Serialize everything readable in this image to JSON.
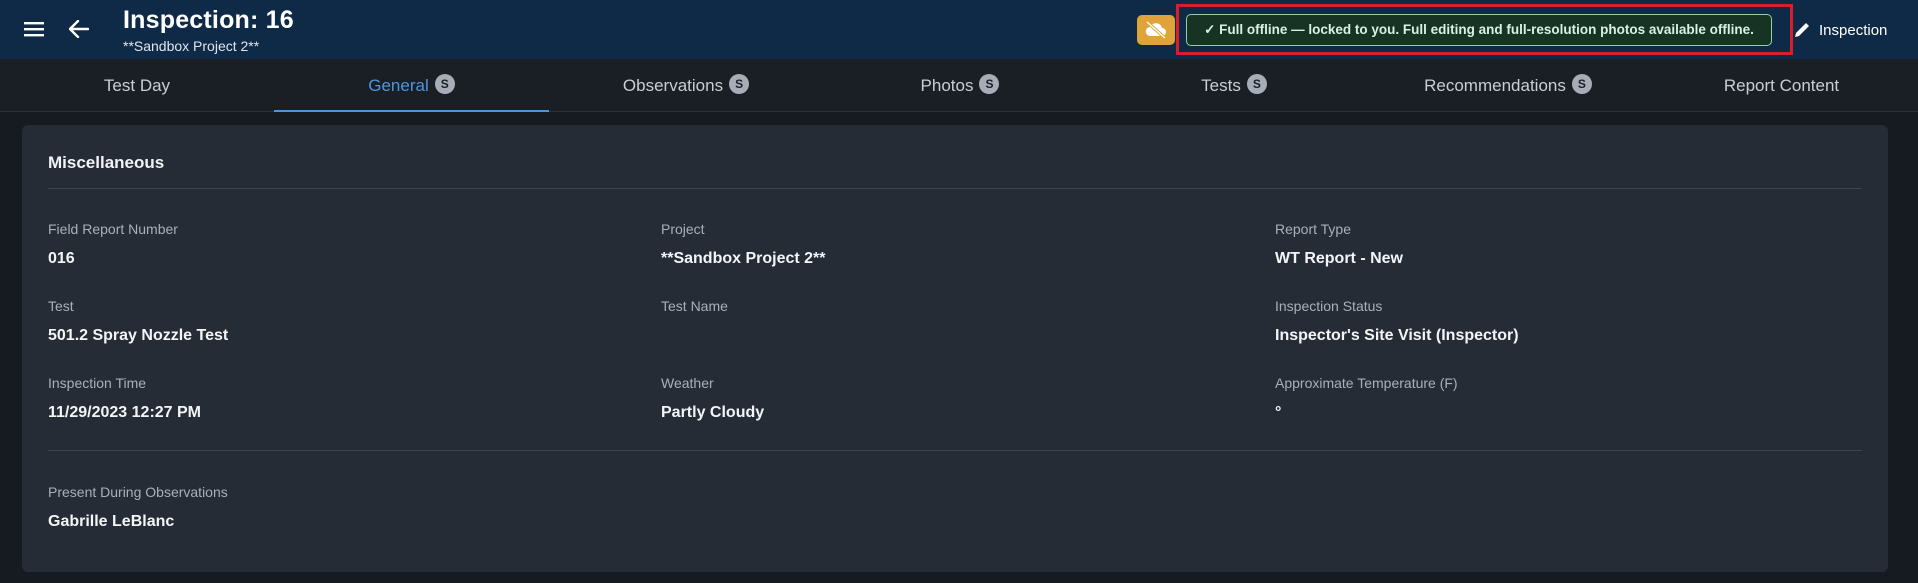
{
  "header": {
    "title": "Inspection: 16",
    "subtitle": "**Sandbox Project 2**",
    "offline_banner": "✓ Full offline — locked to you. Full editing and full-resolution photos available offline.",
    "edit_label": "Inspection"
  },
  "tabs": [
    {
      "label": "Test Day",
      "badge": ""
    },
    {
      "label": "General",
      "badge": "S"
    },
    {
      "label": "Observations",
      "badge": "S"
    },
    {
      "label": "Photos",
      "badge": "S"
    },
    {
      "label": "Tests",
      "badge": "S"
    },
    {
      "label": "Recommendations",
      "badge": "S"
    },
    {
      "label": "Report Content",
      "badge": ""
    }
  ],
  "active_tab": "General",
  "section": {
    "title": "Miscellaneous",
    "fields": {
      "field_report_number": {
        "label": "Field Report Number",
        "value": "016"
      },
      "project": {
        "label": "Project",
        "value": "**Sandbox Project 2**"
      },
      "report_type": {
        "label": "Report Type",
        "value": "WT Report - New"
      },
      "test": {
        "label": "Test",
        "value": "501.2 Spray Nozzle Test"
      },
      "test_name": {
        "label": "Test Name",
        "value": ""
      },
      "inspection_status": {
        "label": "Inspection Status",
        "value": "Inspector's Site Visit (Inspector)"
      },
      "inspection_time": {
        "label": "Inspection Time",
        "value": "11/29/2023 12:27 PM"
      },
      "weather": {
        "label": "Weather",
        "value": "Partly Cloudy"
      },
      "approx_temperature": {
        "label": "Approximate Temperature (F)",
        "value": "°"
      },
      "present_during_observations": {
        "label": "Present During Observations",
        "value": "Gabrille LeBlanc"
      }
    }
  },
  "colors": {
    "appbar": "#0f2a47",
    "accent": "#4e95dc",
    "offline_toggle": "#e0a33a",
    "highlight": "#d81e2a"
  }
}
